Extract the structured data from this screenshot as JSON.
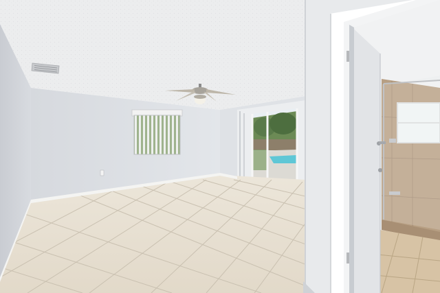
{
  "scene": {
    "kind": "photo",
    "description_parts": [
      "textured-ceiling",
      "ceiling-fan",
      "air-vent",
      "left-wall",
      "back-wall",
      "window-with-vertical-blinds",
      "sliding-glass-door",
      "pool-view",
      "tile-floor",
      "baseboards",
      "open-door",
      "door-frame",
      "walk-in-shower",
      "shower-window",
      "bathroom-floor"
    ]
  },
  "colors": {
    "ceiling": "#ecedee",
    "wall_back": "#dcdfe3",
    "wall_left": "#d4d7dc",
    "wall_right_frame": "#e8eaec",
    "floor_tile": "#e6dfd2",
    "floor_grout": "#c9c0b0",
    "baseboard": "#f4f4f2",
    "door": "#e2e4e7",
    "door_edge": "#c8ccd1",
    "outdoor_green": "#5a7a4a",
    "outdoor_sky": "#e9eff3",
    "pool": "#5fc7d6",
    "shower_tile": "#b79f83",
    "shower_tile_dark": "#9f8770",
    "bath_floor": "#d7c3a5"
  }
}
